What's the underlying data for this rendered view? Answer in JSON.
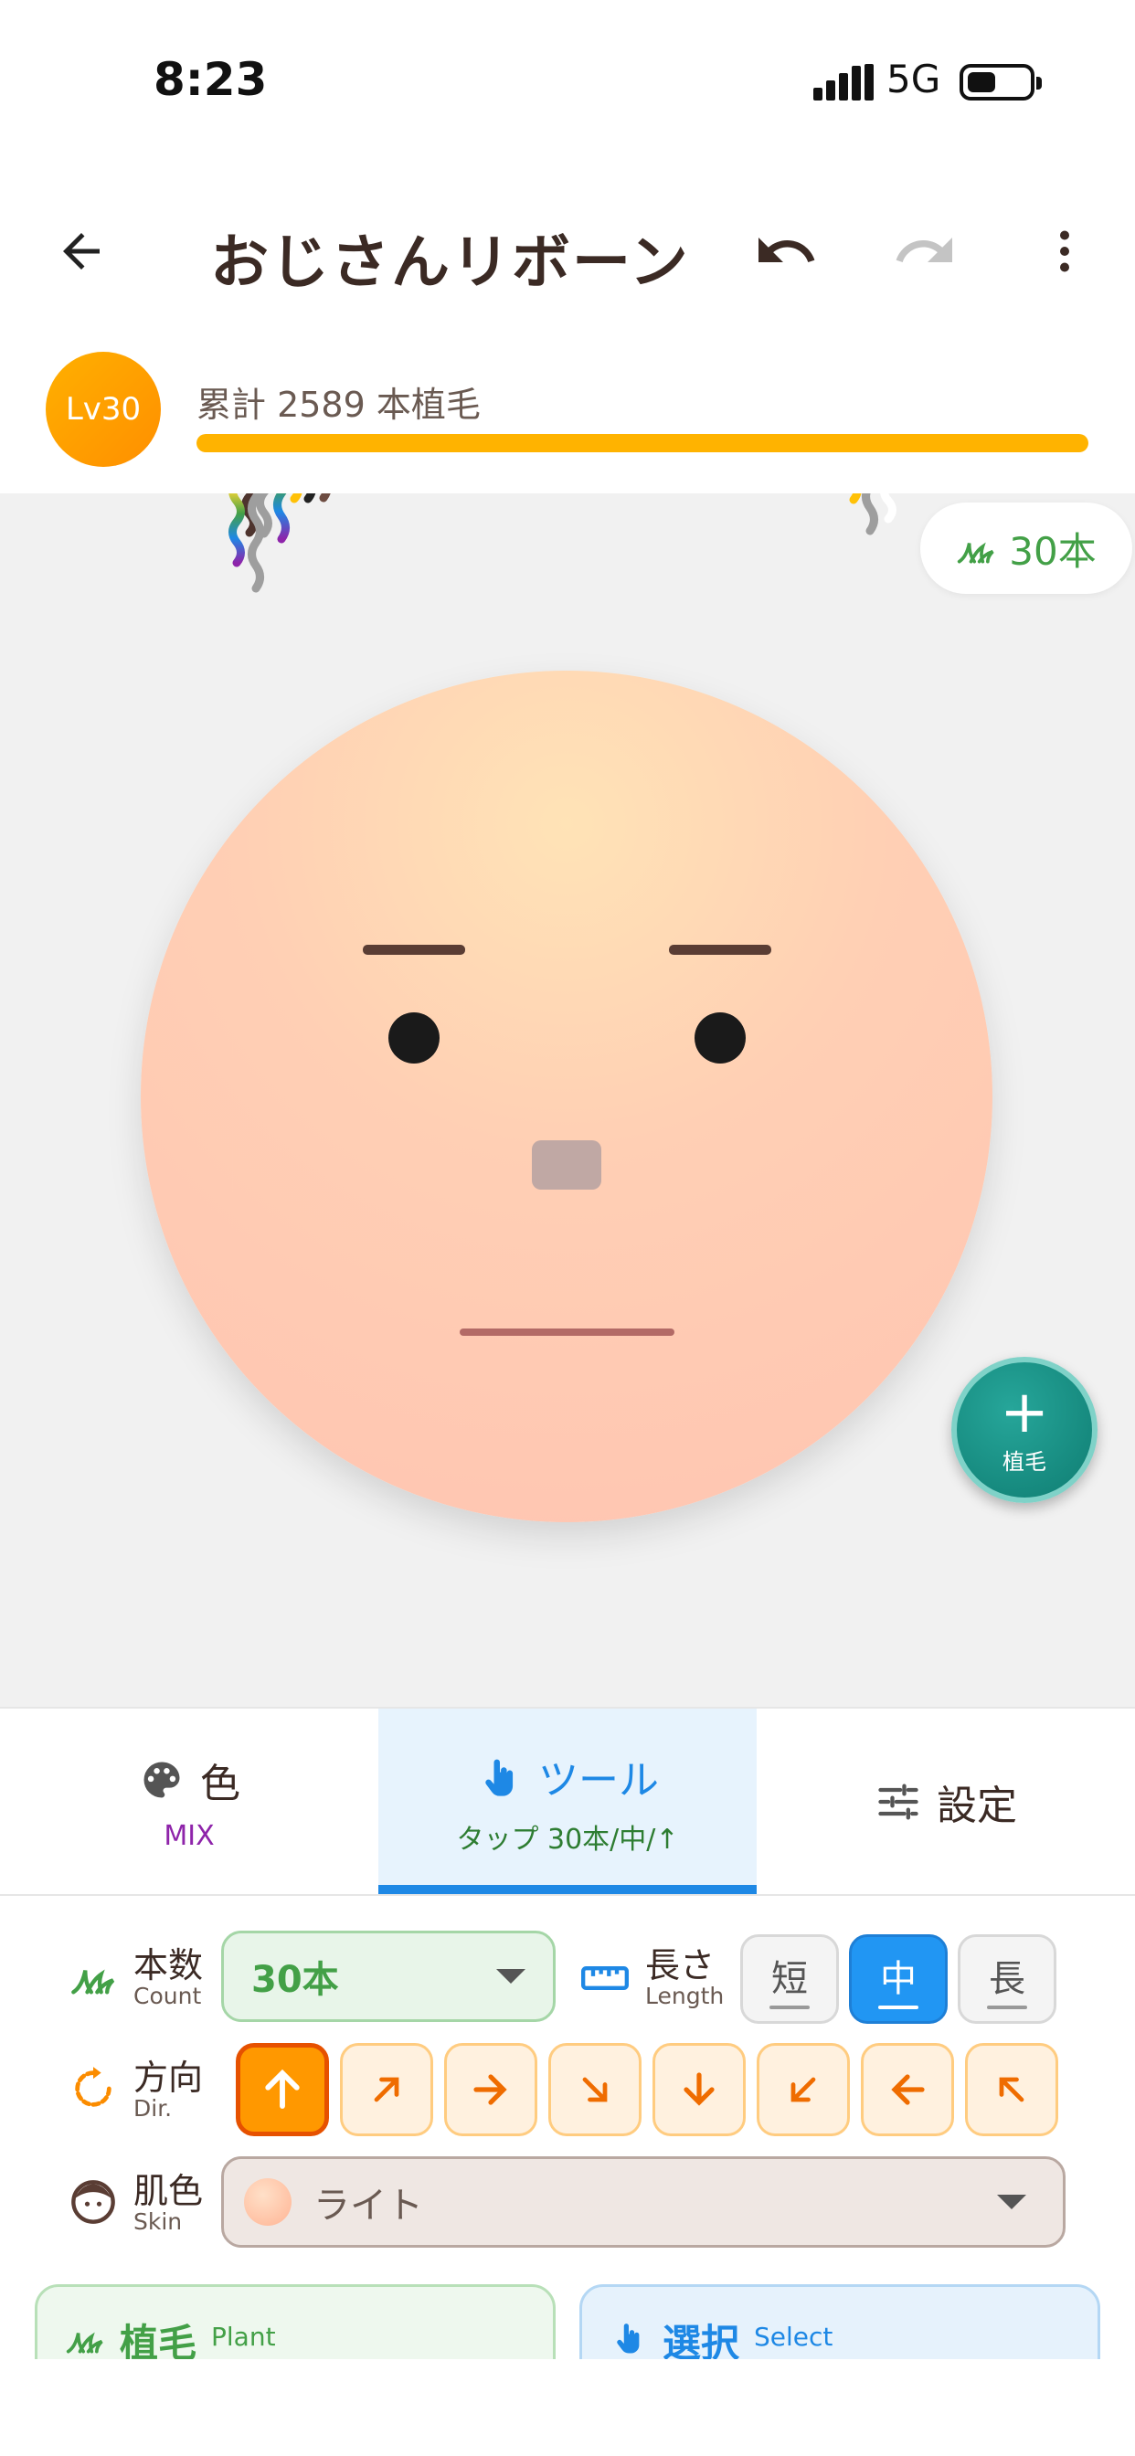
{
  "status_bar": {
    "time": "8:23",
    "network": "5G"
  },
  "header": {
    "title": "おじさんリボーン",
    "back_icon": "arrow-left-icon",
    "undo_icon": "undo-icon",
    "redo_icon": "redo-icon",
    "menu_icon": "more-vert-icon"
  },
  "level": {
    "badge": "Lv30",
    "summary": "累計 2589 本植毛",
    "progress": 1.0
  },
  "canvas": {
    "count_chip": "30本",
    "fab_label": "植毛"
  },
  "tabs": [
    {
      "label": "色",
      "sub": "MIX",
      "icon": "palette-icon",
      "active": false
    },
    {
      "label": "ツール",
      "sub": "タップ 30本/中/↑",
      "icon": "tap-hand-icon",
      "active": true
    },
    {
      "label": "設定",
      "sub": "",
      "icon": "sliders-icon",
      "active": false
    }
  ],
  "controls": {
    "count": {
      "label": "本数",
      "label_en": "Count",
      "value": "30本"
    },
    "length": {
      "label": "長さ",
      "label_en": "Length",
      "options": [
        "短",
        "中",
        "長"
      ],
      "selected": "中"
    },
    "direction": {
      "label": "方向",
      "label_en": "Dir.",
      "options": [
        "↑",
        "↗",
        "→",
        "↘",
        "↓",
        "↙",
        "←",
        "↖"
      ],
      "selected": "↑"
    },
    "skin": {
      "label": "肌色",
      "label_en": "Skin",
      "value": "ライト"
    }
  },
  "modes": {
    "plant": {
      "label": "植毛",
      "label_en": "Plant"
    },
    "select": {
      "label": "選択",
      "label_en": "Select"
    }
  },
  "colors": {
    "accent_orange": "#ff9800",
    "accent_blue": "#1e88e5",
    "accent_green": "#43a047",
    "fab": "#1a9284"
  }
}
